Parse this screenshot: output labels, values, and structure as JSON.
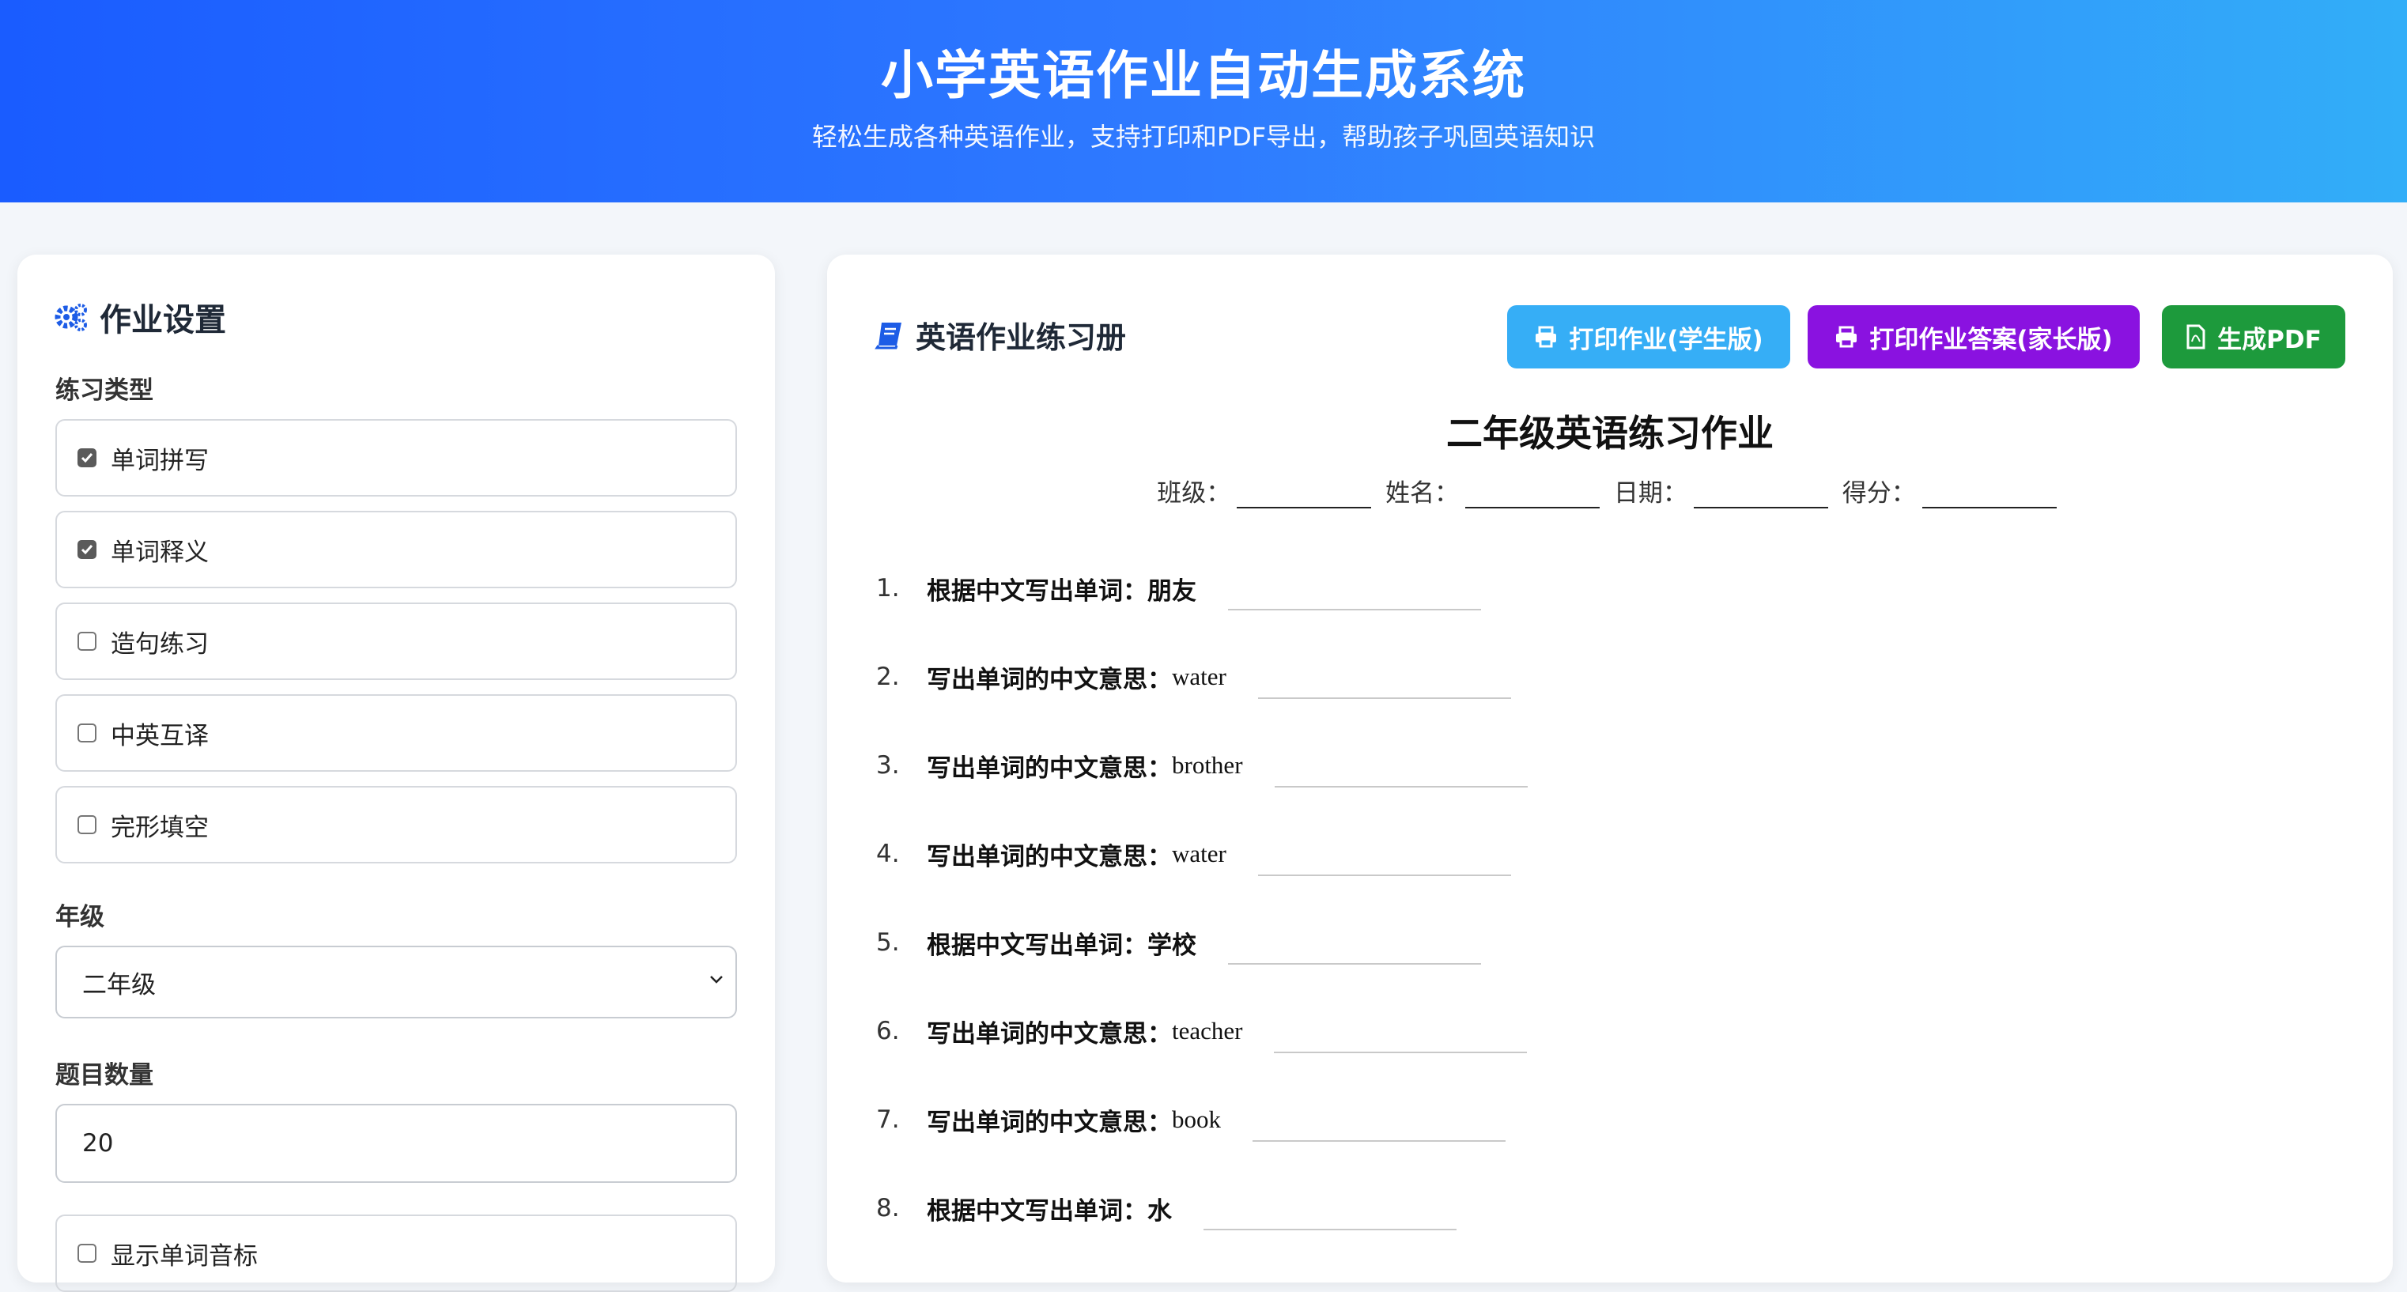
{
  "header": {
    "title": "小学英语作业自动生成系统",
    "subtitle": "轻松生成各种英语作业，支持打印和PDF导出，帮助孩子巩固英语知识"
  },
  "settings": {
    "title": "作业设置",
    "practice_type_label": "练习类型",
    "practice_types": [
      {
        "label": "单词拼写",
        "checked": true
      },
      {
        "label": "单词释义",
        "checked": true
      },
      {
        "label": "造句练习",
        "checked": false
      },
      {
        "label": "中英互译",
        "checked": false
      },
      {
        "label": "完形填空",
        "checked": false
      }
    ],
    "grade_label": "年级",
    "grade_value": "二年级",
    "count_label": "题目数量",
    "count_value": "20",
    "phonetic_label": "显示单词音标",
    "phonetic_checked": false
  },
  "workbook": {
    "title": "英语作业练习册",
    "buttons": {
      "print_student": "打印作业(学生版)",
      "print_answers": "打印作业答案(家长版)",
      "pdf": "生成PDF"
    },
    "colors": {
      "print_student": "#36aef6",
      "print_answers": "#8a12e0",
      "pdf": "#1d9a3c"
    },
    "hw_title": "二年级英语练习作业",
    "meta": {
      "class": "班级：",
      "name": "姓名：",
      "date": "日期：",
      "score": "得分："
    },
    "questions": [
      {
        "num": "1.",
        "prompt": "根据中文写出单词：",
        "word": "朋友"
      },
      {
        "num": "2.",
        "prompt": "写出单词的中文意思：",
        "word": "water"
      },
      {
        "num": "3.",
        "prompt": "写出单词的中文意思：",
        "word": "brother"
      },
      {
        "num": "4.",
        "prompt": "写出单词的中文意思：",
        "word": "water"
      },
      {
        "num": "5.",
        "prompt": "根据中文写出单词：",
        "word": "学校"
      },
      {
        "num": "6.",
        "prompt": "写出单词的中文意思：",
        "word": "teacher"
      },
      {
        "num": "7.",
        "prompt": "写出单词的中文意思：",
        "word": "book"
      },
      {
        "num": "8.",
        "prompt": "根据中文写出单词：",
        "word": "水"
      }
    ]
  }
}
